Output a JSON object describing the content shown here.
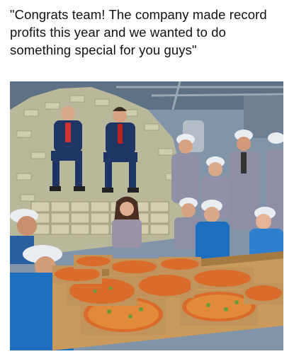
{
  "meme": {
    "caption": "\"Congrats team! The company made record profits this year and we wanted to do something special for you guys\""
  },
  "photo": {
    "icon": "meme-photo-icon"
  },
  "colors": {
    "background": "#ffffff",
    "text": "#111111",
    "money": "#c9c8a7",
    "pizza_sauce": "#d96c2b",
    "hairnet": "#e9edf2",
    "scrubs_blue": "#1f6fc0",
    "suit_navy": "#1f3566",
    "table_wood": "#c99a5b"
  }
}
